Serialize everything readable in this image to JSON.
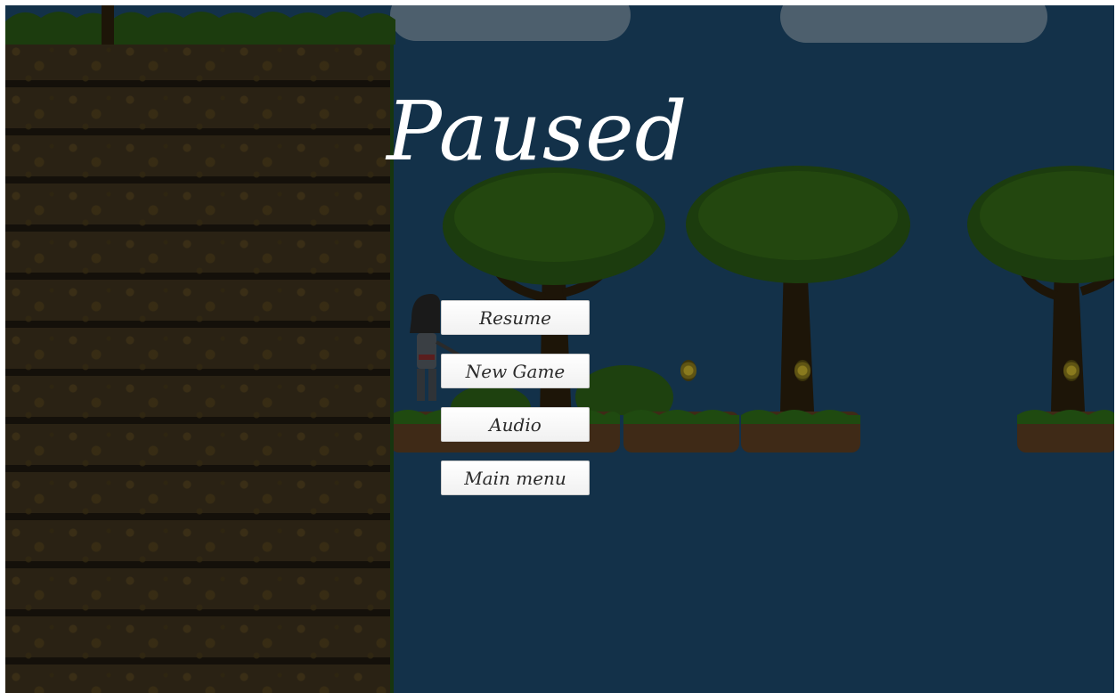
{
  "pause_menu": {
    "title": "Paused",
    "buttons": {
      "resume": "Resume",
      "new_game": "New Game",
      "audio": "Audio",
      "main_menu": "Main menu"
    }
  },
  "colors": {
    "sky": "#133149",
    "cliff_dirt": "#231b10",
    "foliage": "#1c3c0e",
    "button_bg": "#f5f5f5",
    "button_text": "#2b2b2b",
    "title_text": "#ffffff"
  },
  "scene": {
    "coin_count_visible": 3,
    "tree_count_visible": 3
  }
}
